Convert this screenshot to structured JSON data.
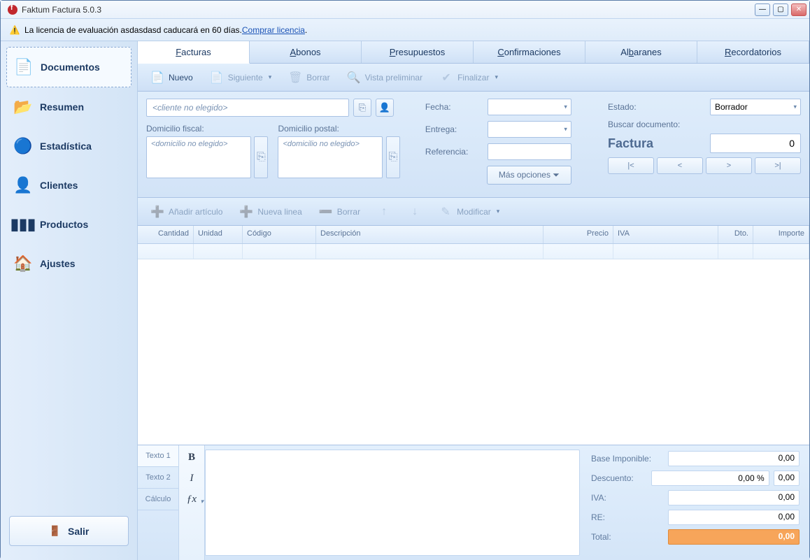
{
  "titlebar": {
    "title": "Faktum Factura 5.0.3"
  },
  "license": {
    "prefix": "La licencia de evaluación asdasdasd caducará en 60 días. ",
    "link": "Comprar licencia",
    "suffix": "."
  },
  "sidebar": {
    "items": [
      {
        "label": "Documentos"
      },
      {
        "label": "Resumen"
      },
      {
        "label": "Estadística"
      },
      {
        "label": "Clientes"
      },
      {
        "label": "Productos"
      },
      {
        "label": "Ajustes"
      }
    ],
    "exit": "Salir"
  },
  "doc_tabs": [
    {
      "label": "Facturas"
    },
    {
      "label": "Abonos"
    },
    {
      "label": "Presupuestos"
    },
    {
      "label": "Confirmaciones"
    },
    {
      "label": "Albaranes"
    },
    {
      "label": "Recordatorios"
    }
  ],
  "toolbar1": {
    "new": "Nuevo",
    "next": "Siguiente",
    "delete": "Borrar",
    "preview": "Vista preliminar",
    "finalize": "Finalizar"
  },
  "form": {
    "client_placeholder": "<cliente no elegido>",
    "fiscal_label": "Domicilio fiscal:",
    "fiscal_placeholder": "<domicilio no elegido>",
    "postal_label": "Domicilio postal:",
    "postal_placeholder": "<domicilio no elegido>",
    "fecha": "Fecha:",
    "entrega": "Entrega:",
    "referencia": "Referencia:",
    "more_options": "Más opciones ⏷",
    "estado": "Estado:",
    "estado_value": "Borrador",
    "buscar": "Buscar documento:",
    "doc_type": "Factura",
    "doc_number": "0",
    "nav_first": "|<",
    "nav_prev": "<",
    "nav_next": ">",
    "nav_last": ">|"
  },
  "toolbar2": {
    "add_article": "Añadir artículo",
    "new_line": "Nueva linea",
    "delete": "Borrar",
    "modify": "Modificar"
  },
  "table": {
    "headers": [
      "Cantidad",
      "Unidad",
      "Código",
      "Descripción",
      "Precio",
      "IVA",
      "Dto.",
      "Importe"
    ]
  },
  "text_tabs": [
    {
      "label": "Texto 1"
    },
    {
      "label": "Texto 2"
    },
    {
      "label": "Cálculo"
    }
  ],
  "totals": {
    "base_label": "Base Imponible:",
    "base_value": "0,00",
    "descuento_label": "Descuento:",
    "descuento_pct": "0,00 %",
    "descuento_value": "0,00",
    "iva_label": "IVA:",
    "iva_value": "0,00",
    "re_label": "RE:",
    "re_value": "0,00",
    "total_label": "Total:",
    "total_value": "0,00"
  }
}
